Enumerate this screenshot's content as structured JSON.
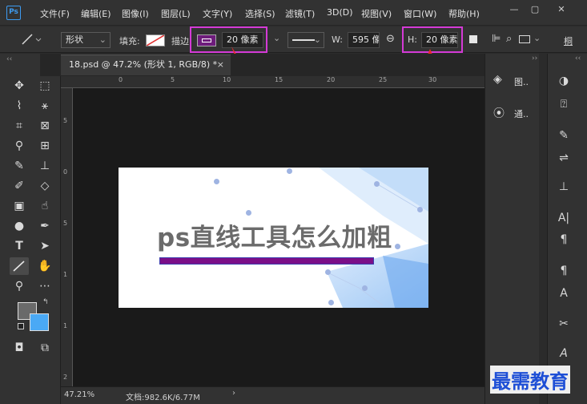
{
  "app": {
    "logo": "Ps"
  },
  "menu": [
    "文件(F)",
    "编辑(E)",
    "图像(I)",
    "图层(L)",
    "文字(Y)",
    "选择(S)",
    "滤镜(T)",
    "3D(D)",
    "视图(V)",
    "窗口(W)",
    "帮助(H)"
  ],
  "options": {
    "tool_mode": "形状",
    "fill_label": "填充:",
    "stroke_label": "描边:",
    "stroke_width": "20 像素",
    "w_label": "W:",
    "w_value": "595 像",
    "h_label": "H:",
    "h_value": "20 像素",
    "align_label": "桐"
  },
  "document": {
    "tab_title": "18.psd @ 47.2% (形状 1, RGB/8) *",
    "close_glyph": "×"
  },
  "artboard": {
    "headline": "ps直线工具怎么加粗"
  },
  "status": {
    "zoom": "47.21%",
    "doc_size": "文档:982.6K/6.77M"
  },
  "panels": {
    "layers_label": "图..",
    "channels_label": "通.."
  },
  "ruler": {
    "top": [
      "0",
      "5",
      "10",
      "15",
      "20",
      "25",
      "30"
    ],
    "left": [
      "5",
      "0",
      "5",
      "1",
      "1",
      "2"
    ]
  },
  "watermark": "最需教育",
  "colors": {
    "accent_highlight": "#d43ad6",
    "stroke_line": "#7b0f88",
    "background_swatch": "#4aa9f5",
    "foreground_swatch": "#6a6a6a"
  }
}
